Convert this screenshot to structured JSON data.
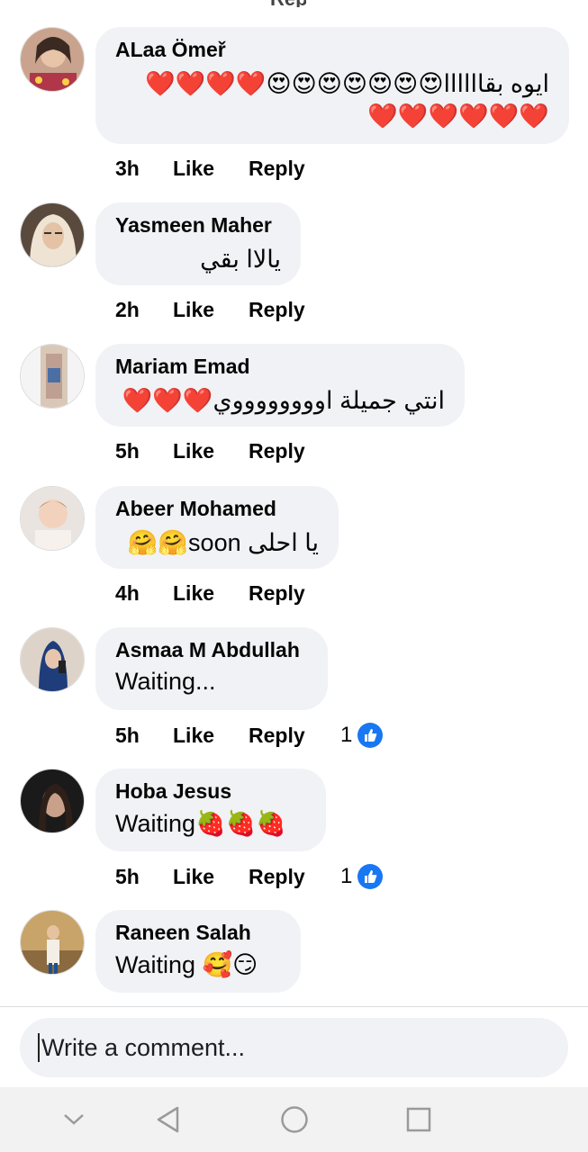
{
  "comments": [
    {
      "author": "ALaa Ömeř",
      "text": "ايوه بقاااااا😍😍😍😍😍😍😍❤️❤️❤️❤️❤️❤️❤️❤️❤️❤️",
      "time": "3h",
      "like": "Like",
      "reply": "Reply",
      "reactions": ""
    },
    {
      "author": "Yasmeen Maher",
      "text": "يالاا بقي",
      "time": "2h",
      "like": "Like",
      "reply": "Reply",
      "reactions": ""
    },
    {
      "author": "Mariam Emad",
      "text": "انتي جميلة اووووووووي❤️❤️❤️",
      "time": "5h",
      "like": "Like",
      "reply": "Reply",
      "reactions": ""
    },
    {
      "author": "Abeer Mohamed",
      "text": "يا احلى soon🤗🤗",
      "time": "4h",
      "like": "Like",
      "reply": "Reply",
      "reactions": ""
    },
    {
      "author": "Asmaa M Abdullah",
      "text": "Waiting...",
      "time": "5h",
      "like": "Like",
      "reply": "Reply",
      "reactions": "1"
    },
    {
      "author": "Hoba Jesus",
      "text": "Waiting🍓🍓🍓",
      "time": "5h",
      "like": "Like",
      "reply": "Reply",
      "reactions": "1"
    },
    {
      "author": "Raneen Salah",
      "text": "Waiting 🥰😏",
      "time": "",
      "like": "",
      "reply": "",
      "reactions": ""
    }
  ],
  "composer": {
    "placeholder": "Write a comment..."
  },
  "navbar": [
    "back-chevron-icon",
    "back-triangle-icon",
    "home-circle-icon",
    "recents-square-icon"
  ],
  "colors": {
    "bubble": "#f0f2f5",
    "like_blue": "#1877f2",
    "navbar_bg": "#f2f2f2"
  }
}
